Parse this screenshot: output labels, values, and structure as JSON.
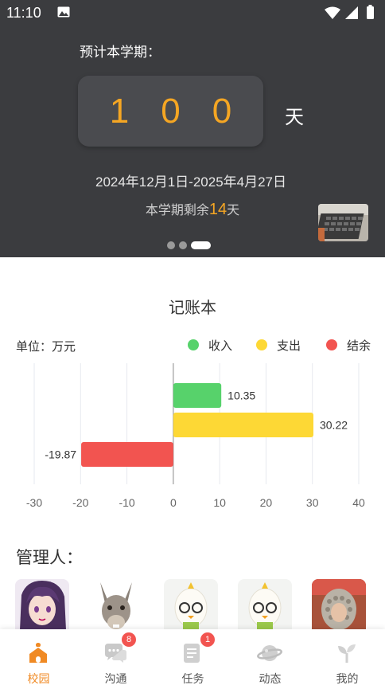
{
  "status_bar": {
    "time": "11:10"
  },
  "semester": {
    "estimate_label": "预计本学期：",
    "digits": [
      "1",
      "0",
      "0"
    ],
    "unit": "天",
    "date_range": "2024年12月1日-2025年4月27日",
    "remaining_prefix": "本学期剩余",
    "remaining_days": "14",
    "remaining_suffix": "天"
  },
  "carousel": {
    "count": 3,
    "active_index": 2
  },
  "ledger": {
    "title": "记账本",
    "unit_label": "单位：万元",
    "legend": [
      {
        "label": "收入",
        "color": "#57d26b"
      },
      {
        "label": "支出",
        "color": "#fdd835"
      },
      {
        "label": "结余",
        "color": "#f25450"
      }
    ]
  },
  "chart_data": {
    "type": "bar",
    "orientation": "horizontal",
    "series": [
      {
        "name": "收入",
        "value": 10.35,
        "label": "10.35",
        "color": "#57d26b"
      },
      {
        "name": "支出",
        "value": 30.22,
        "label": "30.22",
        "color": "#fdd835"
      },
      {
        "name": "结余",
        "value": -19.87,
        "label": "-19.87",
        "color": "#f25450"
      }
    ],
    "xlim": [
      -30,
      40
    ],
    "xticks": [
      -30,
      -20,
      -10,
      0,
      10,
      20,
      30,
      40
    ],
    "grid": true,
    "legend_position": "top-right",
    "unit": "万元"
  },
  "managers": {
    "title": "管理人：",
    "avatars": [
      {
        "icon": "anime-character-avatar"
      },
      {
        "icon": "donkey-avatar"
      },
      {
        "icon": "egg-mascot-avatar"
      },
      {
        "icon": "egg-mascot-avatar"
      },
      {
        "icon": "photo-avatar"
      }
    ]
  },
  "bottom_nav": {
    "items": [
      {
        "label": "校园",
        "icon": "campus-icon",
        "active": true,
        "badge": ""
      },
      {
        "label": "沟通",
        "icon": "chat-icon",
        "active": false,
        "badge": "8"
      },
      {
        "label": "任务",
        "icon": "task-icon",
        "active": false,
        "badge": "1"
      },
      {
        "label": "动态",
        "icon": "planet-icon",
        "active": false,
        "badge": ""
      },
      {
        "label": "我的",
        "icon": "sprout-icon",
        "active": false,
        "badge": ""
      }
    ]
  }
}
